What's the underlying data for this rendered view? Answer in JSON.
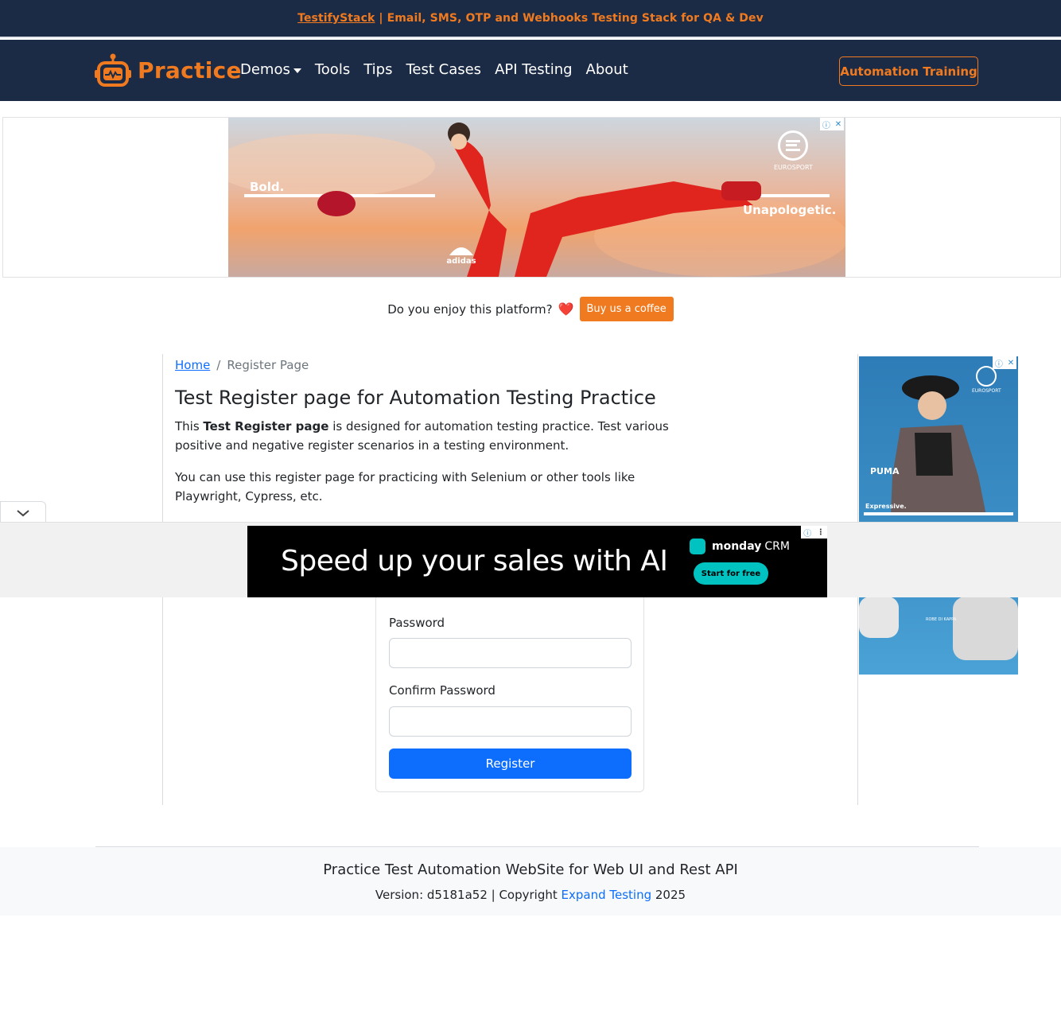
{
  "announcement": {
    "link_text": "TestifyStack",
    "text": " | Email, SMS, OTP and Webhooks Testing Stack for QA & Dev"
  },
  "navbar": {
    "brand": "Practice",
    "links": [
      "Demos",
      "Tools",
      "Tips",
      "Test Cases",
      "API Testing",
      "About"
    ],
    "cta": "Automation Training"
  },
  "ads": {
    "top": {
      "left_text": "Bold.",
      "right_text": "Unapologetic.",
      "brand": "adidas",
      "sponsor": "EUROSPORT"
    },
    "side": {
      "sponsor": "EUROSPORT",
      "brand": "PUMA",
      "tagline": "Expressive.",
      "brand2": "ROBE DI KAPPA"
    },
    "bottom": {
      "headline": "Speed up your sales with AI",
      "brand": "monday",
      "brand_suffix": "CRM",
      "cta": "Start for free"
    }
  },
  "support": {
    "question": "Do you enjoy this platform?",
    "heart": "❤️",
    "button": "Buy us a coffee"
  },
  "breadcrumb": {
    "home": "Home",
    "separator": "/",
    "current": "Register Page"
  },
  "main": {
    "title": "Test Register page for Automation Testing Practice",
    "desc_prefix": "This ",
    "desc_bold": "Test Register page",
    "desc_suffix": " is designed for automation testing practice. Test various positive and negative register scenarios in a testing environment.",
    "desc2": "You can use this register page for practicing with Selenium or other tools like Playwright, Cypress, etc."
  },
  "form": {
    "password_label": "Password",
    "password_value": "",
    "confirm_label": "Confirm Password",
    "confirm_value": "",
    "submit": "Register"
  },
  "footer": {
    "title": "Practice Test Automation WebSite for Web UI and Rest API",
    "version_text": "Version: d5181a52 | Copyright ",
    "company": "Expand Testing",
    "year": " 2025"
  },
  "colors": {
    "navy": "#1c2b45",
    "orange": "#f07a1f",
    "primary": "#0d6efd"
  }
}
